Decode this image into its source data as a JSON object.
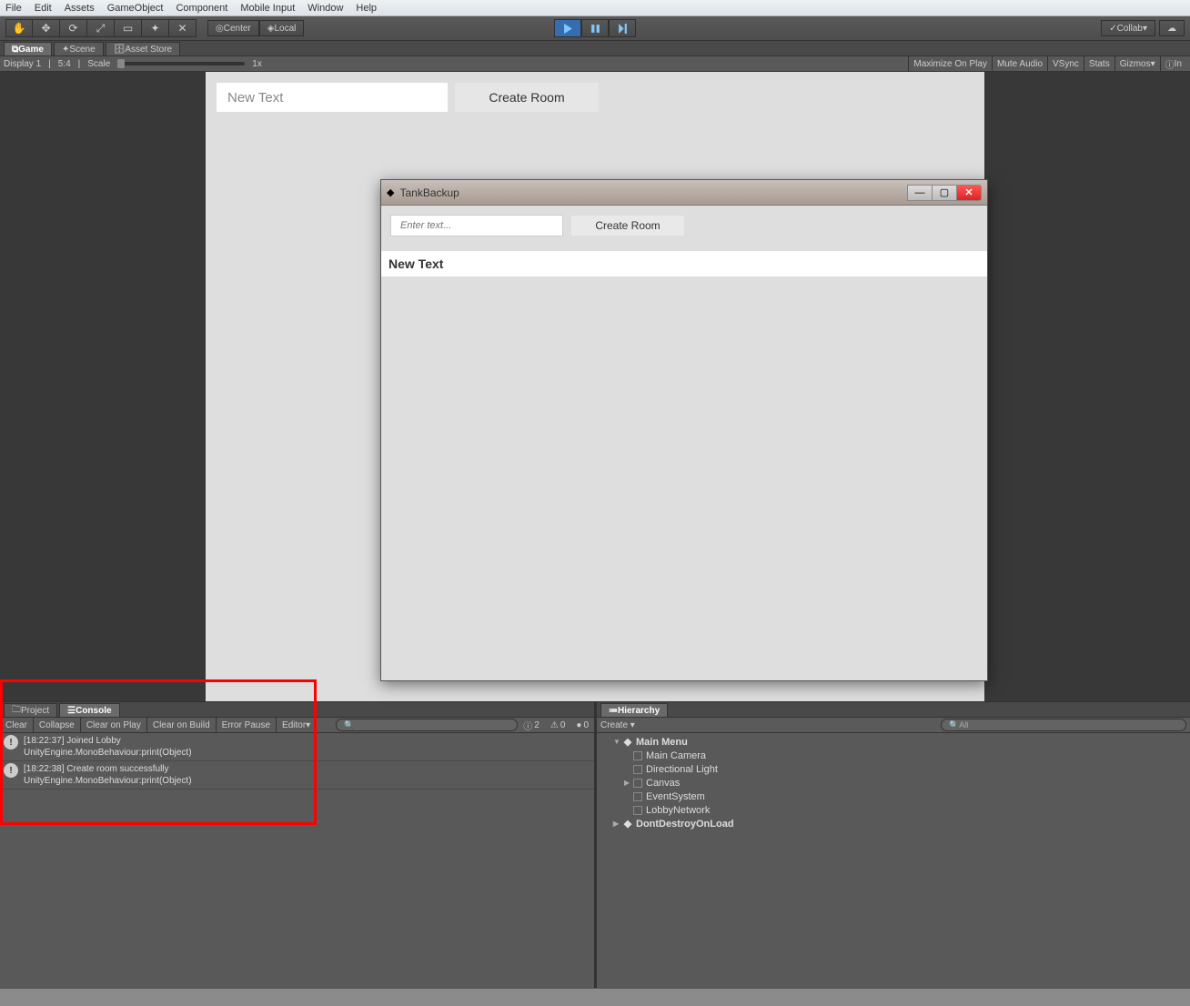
{
  "menu": {
    "file": "File",
    "edit": "Edit",
    "assets": "Assets",
    "gameobject": "GameObject",
    "component": "Component",
    "mobile": "Mobile Input",
    "window": "Window",
    "help": "Help"
  },
  "toolbar": {
    "center": "Center",
    "local": "Local",
    "collab": "Collab"
  },
  "tabs": {
    "game": "Game",
    "scene": "Scene",
    "asset_store": "Asset Store"
  },
  "controlbar": {
    "display": "Display 1",
    "aspect": "5:4",
    "scale_label": "Scale",
    "scale_value": "1x",
    "maximize": "Maximize On Play",
    "mute": "Mute Audio",
    "vsync": "VSync",
    "stats": "Stats",
    "gizmos": "Gizmos",
    "inspector": "In"
  },
  "game": {
    "input_placeholder": "New Text",
    "create_room": "Create Room"
  },
  "floating": {
    "title": "TankBackup",
    "input_placeholder": "Enter text...",
    "create_room": "Create Room",
    "body_text": "New Text"
  },
  "console": {
    "tabs": {
      "project": "Project",
      "console": "Console"
    },
    "buttons": {
      "clear": "Clear",
      "collapse": "Collapse",
      "clear_play": "Clear on Play",
      "clear_build": "Clear on Build",
      "error_pause": "Error Pause",
      "editor": "Editor"
    },
    "counts": {
      "info": "2",
      "warn": "0",
      "error": "0"
    },
    "logs": [
      {
        "line1": "[18:22:37] Joined Lobby",
        "line2": "UnityEngine.MonoBehaviour:print(Object)"
      },
      {
        "line1": "[18:22:38] Create room successfully",
        "line2": "UnityEngine.MonoBehaviour:print(Object)"
      }
    ]
  },
  "hierarchy": {
    "tab": "Hierarchy",
    "create": "Create",
    "search_placeholder": "All",
    "scene": "Main Menu",
    "items": [
      "Main Camera",
      "Directional Light",
      "Canvas",
      "EventSystem",
      "LobbyNetwork"
    ],
    "dont_destroy": "DontDestroyOnLoad"
  }
}
